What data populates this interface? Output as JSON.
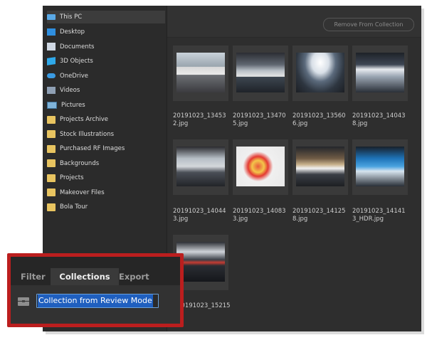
{
  "sidebar": {
    "items": [
      {
        "label": "This PC",
        "icon": "computer-icon",
        "selected": true
      },
      {
        "label": "Desktop",
        "icon": "desktop-icon"
      },
      {
        "label": "Documents",
        "icon": "documents-icon"
      },
      {
        "label": "3D Objects",
        "icon": "3d-objects-icon"
      },
      {
        "label": "OneDrive",
        "icon": "cloud-icon"
      },
      {
        "label": "Videos",
        "icon": "videos-icon"
      },
      {
        "label": "Pictures",
        "icon": "pictures-icon"
      },
      {
        "label": "Projects Archive",
        "icon": "folder-icon"
      },
      {
        "label": "Stock Illustrations",
        "icon": "folder-icon"
      },
      {
        "label": "Purchased RF Images",
        "icon": "folder-icon"
      },
      {
        "label": "Backgrounds",
        "icon": "folder-icon"
      },
      {
        "label": "Projects",
        "icon": "folder-icon"
      },
      {
        "label": "Makeover Files",
        "icon": "folder-icon"
      },
      {
        "label": "Bola Tour",
        "icon": "folder-icon"
      }
    ]
  },
  "toolbar": {
    "remove_from_collection": "Remove From Collection"
  },
  "thumbnails": [
    {
      "caption": "20191023_13453\n2.jpg"
    },
    {
      "caption": "20191023_13470\n5.jpg"
    },
    {
      "caption": "20191023_13560\n6.jpg"
    },
    {
      "caption": "20191023_14043\n8.jpg"
    },
    {
      "caption": "20191023_14044\n3.jpg"
    },
    {
      "caption": "20191023_14083\n3.jpg"
    },
    {
      "caption": "20191023_14125\n8.jpg"
    },
    {
      "caption": "20191023_14141\n3_HDR.jpg"
    },
    {
      "caption": "20191023_15215"
    }
  ],
  "panel": {
    "tabs": [
      "Filter",
      "Collections",
      "Export"
    ],
    "active_tab": "Collections",
    "collection_name": "Collection from Review Mode"
  },
  "colors": {
    "highlight_border": "#bb1e1e",
    "selection": "#1f5fbf",
    "app_background": "#2f2f2f"
  }
}
